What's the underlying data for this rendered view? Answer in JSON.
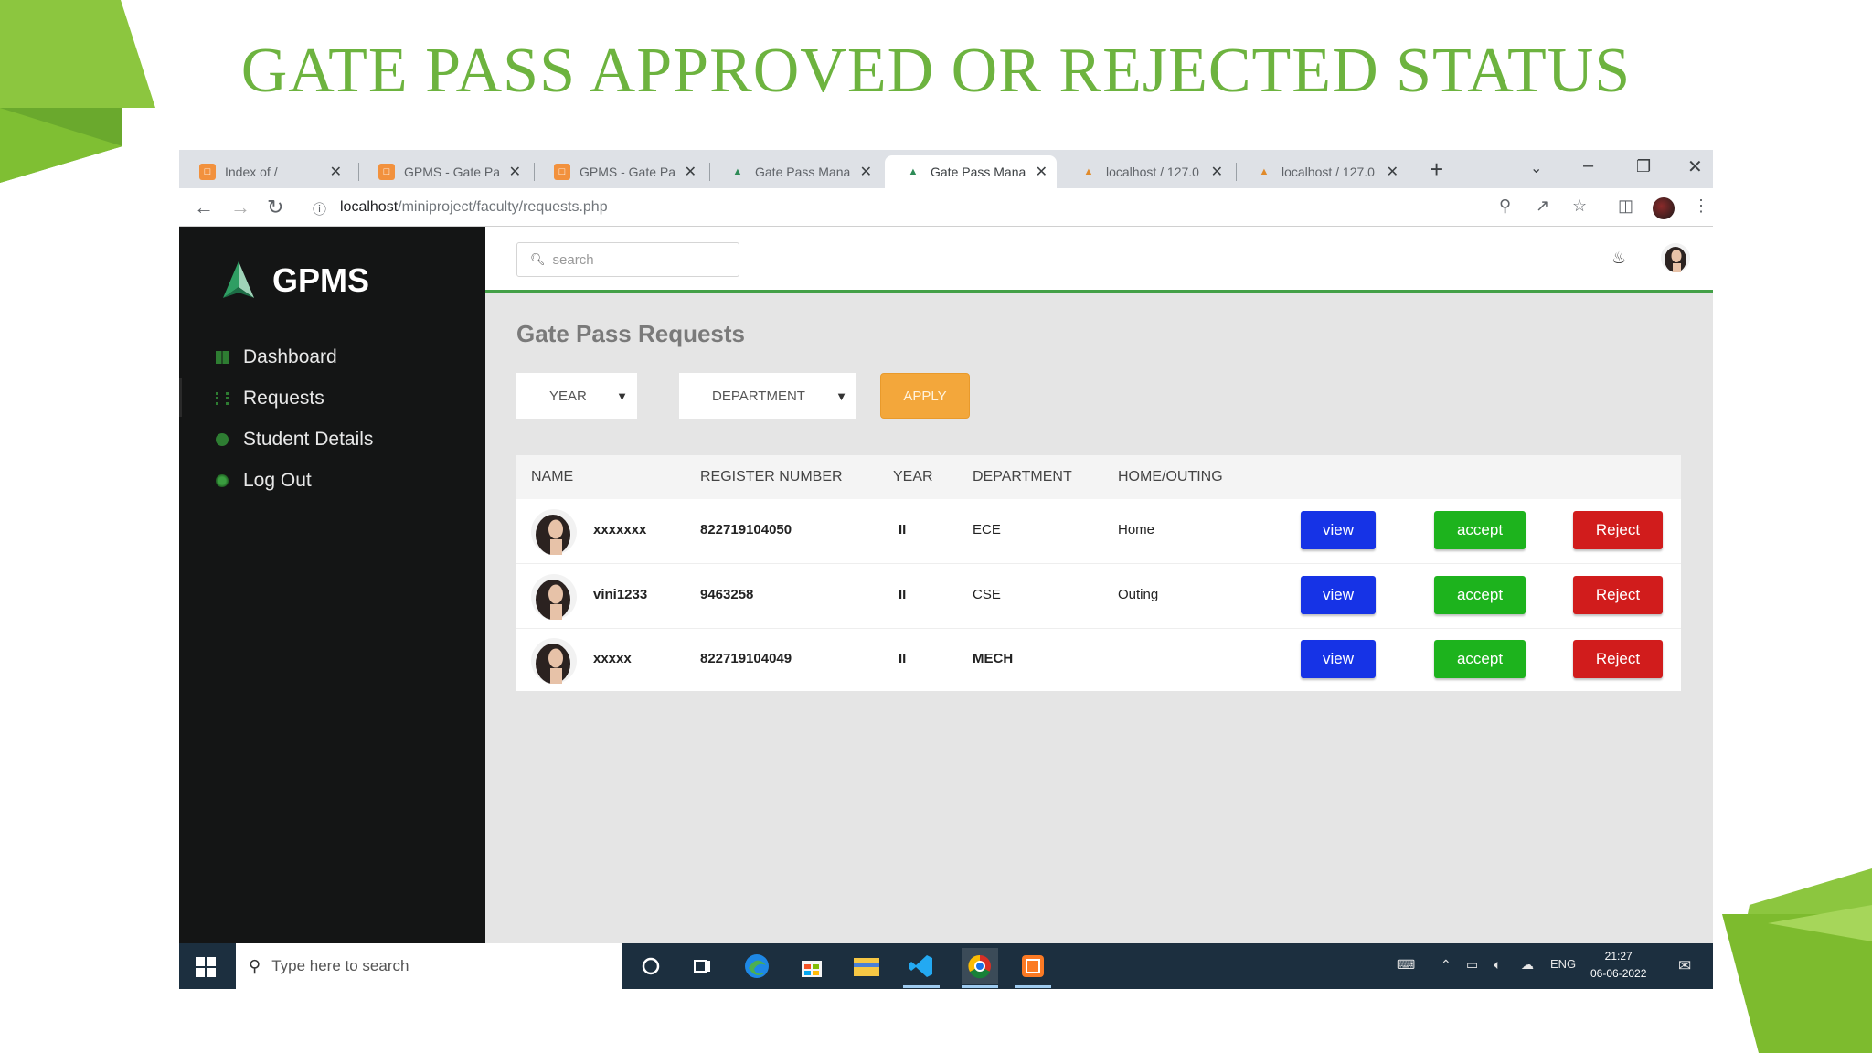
{
  "slide": {
    "title": "GATE PASS APPROVED OR REJECTED STATUS"
  },
  "browser": {
    "tabs": [
      {
        "title": "Index of /",
        "icon": "xampp-icon",
        "active": false
      },
      {
        "title": "GPMS - Gate Pa",
        "icon": "xampp-icon",
        "active": false
      },
      {
        "title": "GPMS - Gate Pa",
        "icon": "xampp-icon",
        "active": false
      },
      {
        "title": "Gate Pass Mana",
        "icon": "gpms-logo-icon",
        "active": false
      },
      {
        "title": "Gate Pass Mana",
        "icon": "gpms-logo-icon",
        "active": true
      },
      {
        "title": "localhost / 127.0",
        "icon": "phpmyadmin-icon",
        "active": false
      },
      {
        "title": "localhost / 127.0",
        "icon": "phpmyadmin-icon",
        "active": false
      }
    ],
    "url_host": "localhost",
    "url_path": "/miniproject/faculty/requests.php"
  },
  "app": {
    "brand": "GPMS",
    "nav": [
      {
        "label": "Dashboard",
        "icon": "dashboard-icon"
      },
      {
        "label": "Requests",
        "icon": "requests-icon"
      },
      {
        "label": "Student Details",
        "icon": "student-icon"
      },
      {
        "label": "Log Out",
        "icon": "logout-icon"
      }
    ],
    "search_placeholder": "search",
    "page_heading": "Gate Pass Requests",
    "filters": {
      "year_selected": "YEAR",
      "department_selected": "DEPARTMENT",
      "apply_label": "APPLY"
    },
    "table": {
      "headers": [
        "NAME",
        "REGISTER NUMBER",
        "YEAR",
        "DEPARTMENT",
        "HOME/OUTING"
      ],
      "rows": [
        {
          "name": "xxxxxxx",
          "register_number": "822719104050",
          "year": "II",
          "department": "ECE",
          "type": "Home"
        },
        {
          "name": "vini1233",
          "register_number": "9463258",
          "year": "II",
          "department": "CSE",
          "type": "Outing"
        },
        {
          "name": "xxxxx",
          "register_number": "822719104049",
          "year": "II",
          "department": "MECH",
          "type": ""
        }
      ],
      "view_label": "view",
      "accept_label": "accept",
      "reject_label": "Reject"
    },
    "colors": {
      "accent_green": "#43a047",
      "view_blue": "#1633e6",
      "accept_green": "#1db31d",
      "reject_red": "#d11c1c",
      "apply_orange": "#f3a73b",
      "sidebar_bg": "#141515"
    }
  },
  "taskbar": {
    "search_placeholder": "Type here to search",
    "language": "ENG",
    "time": "21:27",
    "date": "06-06-2022"
  }
}
